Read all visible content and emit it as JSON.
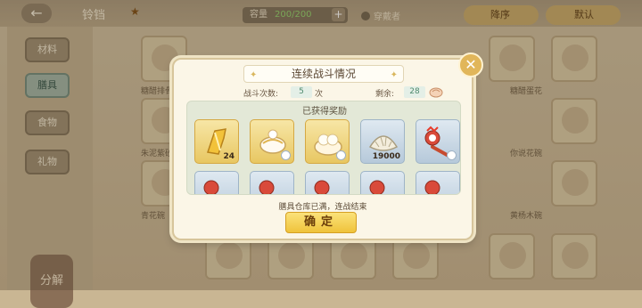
{
  "background": {
    "back_icon": "back-arrow-icon",
    "title": "铃铛",
    "star_icon": "star-icon",
    "count_prefix": "容量",
    "count_value": "200/200",
    "plus_icon": "plus-icon",
    "wear_label": "穿戴者",
    "sort_label": "降序",
    "default_label": "默认",
    "sidebar_tabs": [
      "材料",
      "膳具",
      "食物",
      "礼物"
    ],
    "active_tab": "膳具",
    "split_label": "分解",
    "grid_names": [
      "糖醋排骨",
      "糖醋蛋花",
      "朱泥紫砂",
      "你说花碗",
      "青花碗",
      "黄杨木碗"
    ]
  },
  "modal": {
    "title": "连续战斗情况",
    "battles_label": "战斗次数:",
    "battles_value": "5",
    "battles_unit": "次",
    "remaining_label": "剩余:",
    "remaining_value": "28",
    "remaining_icon": "steamed-bun-icon",
    "rewards_title": "已获得奖励",
    "rewards": [
      {
        "icon": "gold-ingot-icon",
        "frame": "gold",
        "count": "24"
      },
      {
        "icon": "noodle-bowl-icon",
        "frame": "gold",
        "count": ""
      },
      {
        "icon": "steamed-bun-bowl-icon",
        "frame": "gold",
        "count": ""
      },
      {
        "icon": "dumpling-icon",
        "frame": "blue",
        "count": "19000"
      },
      {
        "icon": "rooster-spoon-icon",
        "frame": "blue",
        "count": ""
      },
      {
        "icon": "rooster-spoon-icon",
        "frame": "blue",
        "count": ""
      },
      {
        "icon": "rooster-spoon-icon",
        "frame": "blue",
        "count": ""
      },
      {
        "icon": "rooster-spoon-icon",
        "frame": "blue",
        "count": ""
      },
      {
        "icon": "rooster-spoon-icon",
        "frame": "blue",
        "count": ""
      },
      {
        "icon": "rooster-spoon-icon",
        "frame": "blue",
        "count": ""
      }
    ],
    "footer_text": "膳具仓库已满，连战结束",
    "confirm_label": "确定",
    "close_icon": "close-icon"
  },
  "colors": {
    "confirm_gold": "#efc33b",
    "panel_green": "#e3e8d7",
    "value_green": "#4f8a6e"
  }
}
